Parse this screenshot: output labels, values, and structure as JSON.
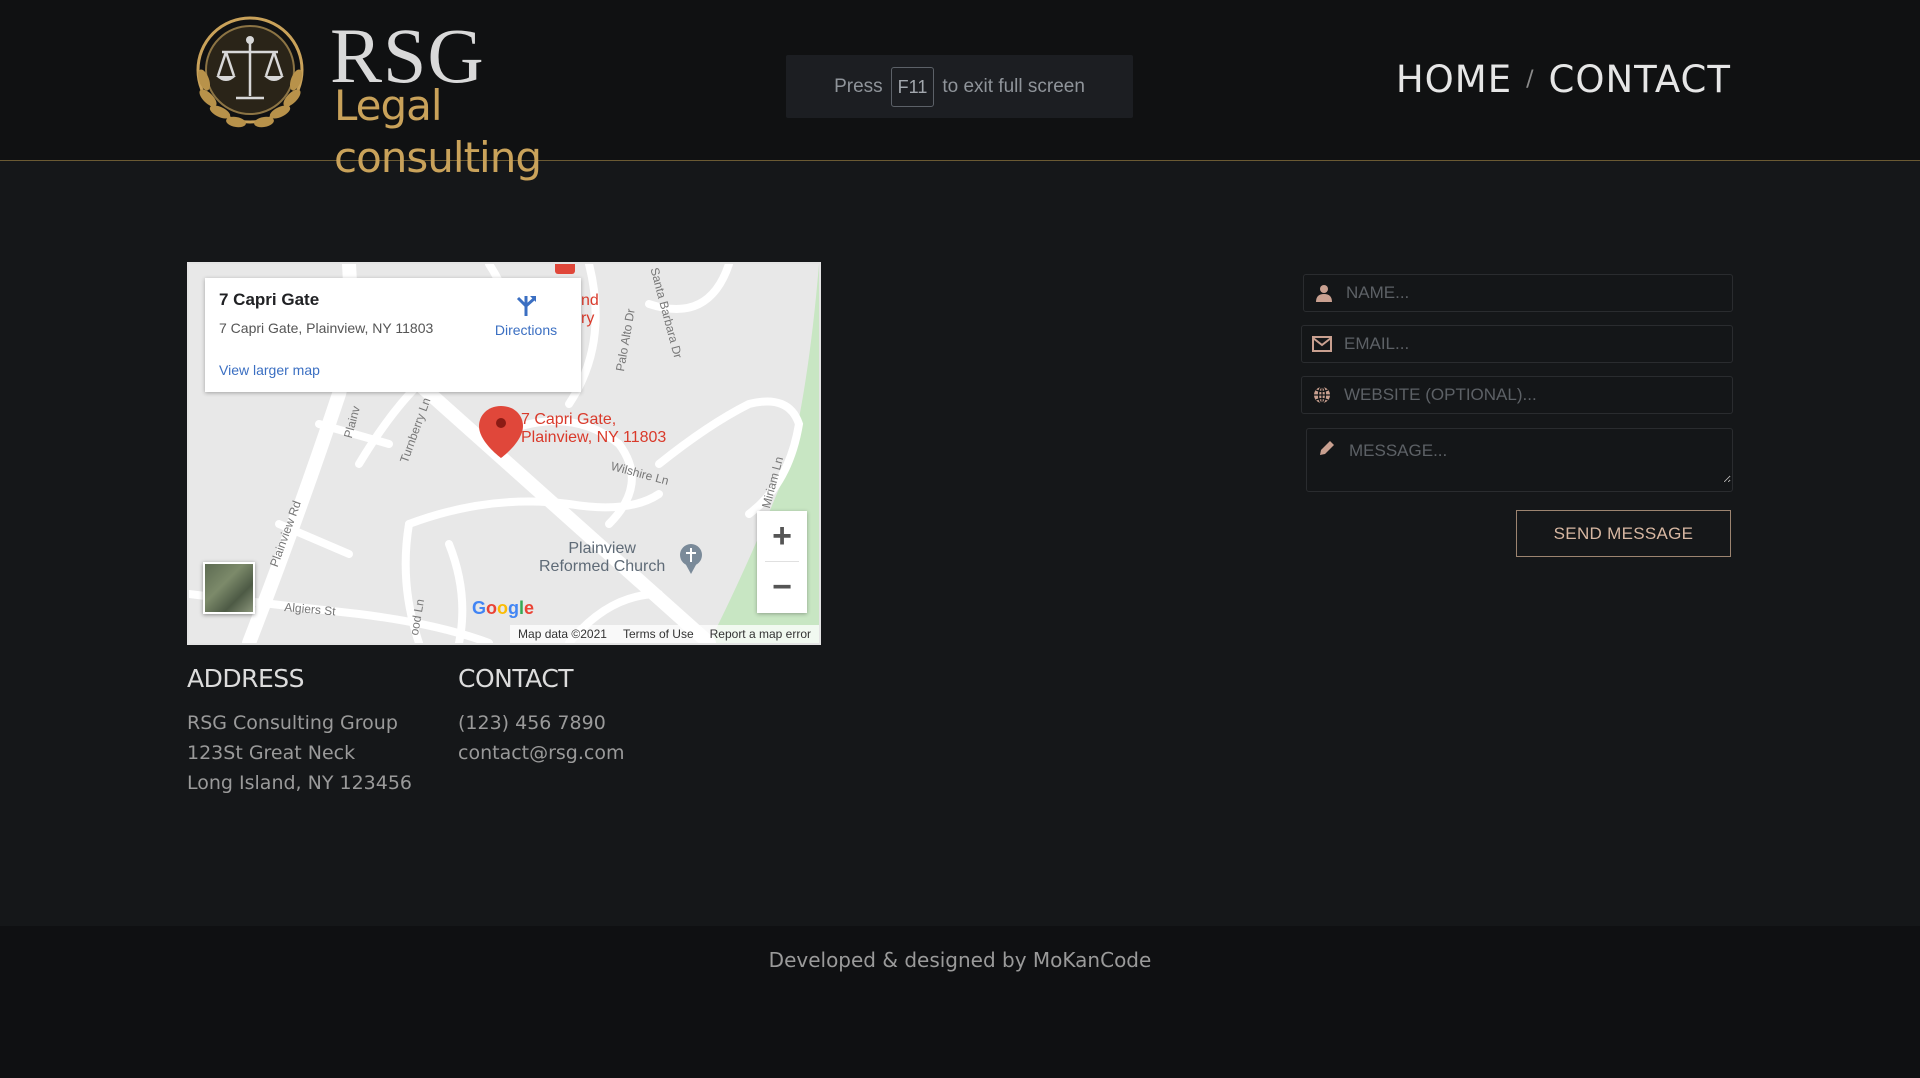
{
  "header": {
    "logo_title": "RSG",
    "logo_subtitle": "Legal consulting",
    "fullscreen_notice": {
      "prefix": "Press",
      "key": "F11",
      "suffix": "to exit full screen"
    },
    "nav": {
      "home": "HOME",
      "separator": "/",
      "contact": "CONTACT"
    }
  },
  "map": {
    "place_title": "7 Capri Gate",
    "place_address": "7 Capri Gate, Plainview, NY 11803",
    "directions_label": "Directions",
    "larger_map_label": "View larger map",
    "pin_label_line1": "7 Capri Gate,",
    "pin_label_line2": "Plainview, NY 11803",
    "church_line1": "Plainview",
    "church_line2": "Reformed Church",
    "roads": {
      "plainview_rd": "Plainview Rd",
      "plainv": "Plainv",
      "turnberry": "Turnberry Ln",
      "palo_alto": "Palo Alto Dr",
      "santa_barbara": "Santa Barbara Dr",
      "wilshire": "Wilshire Ln",
      "miriam": "Miriam Ln",
      "algiers": "Algiers St",
      "wood_ln": "ood Ln",
      "partial_nd": "nd",
      "partial_ry": "ry"
    },
    "zoom_in": "+",
    "zoom_out": "−",
    "google": "Google",
    "footer": {
      "map_data": "Map data ©2021",
      "terms": "Terms of Use",
      "report": "Report a map error"
    }
  },
  "address": {
    "heading": "ADDRESS",
    "lines": [
      "RSG Consulting Group",
      "123St Great Neck",
      "Long Island, NY 123456"
    ]
  },
  "contact": {
    "heading": "CONTACT",
    "phone": "(123) 456 7890",
    "email": "contact@rsg.com"
  },
  "form": {
    "name_placeholder": "NAME...",
    "email_placeholder": "EMAIL...",
    "website_placeholder": "WEBSITE (OPTIONAL)...",
    "message_placeholder": "MESSAGE...",
    "send_label": "SEND MESSAGE",
    "icons": [
      "user-icon",
      "envelope-icon",
      "globe-icon",
      "pencil-icon"
    ]
  },
  "footer": {
    "credit": "Developed & designed by MoKanCode"
  },
  "colors": {
    "gold": "#c9a25a",
    "background": "#151719",
    "header": "#101112",
    "button_border": "#9c8470",
    "pin_red": "#d93a2b"
  }
}
